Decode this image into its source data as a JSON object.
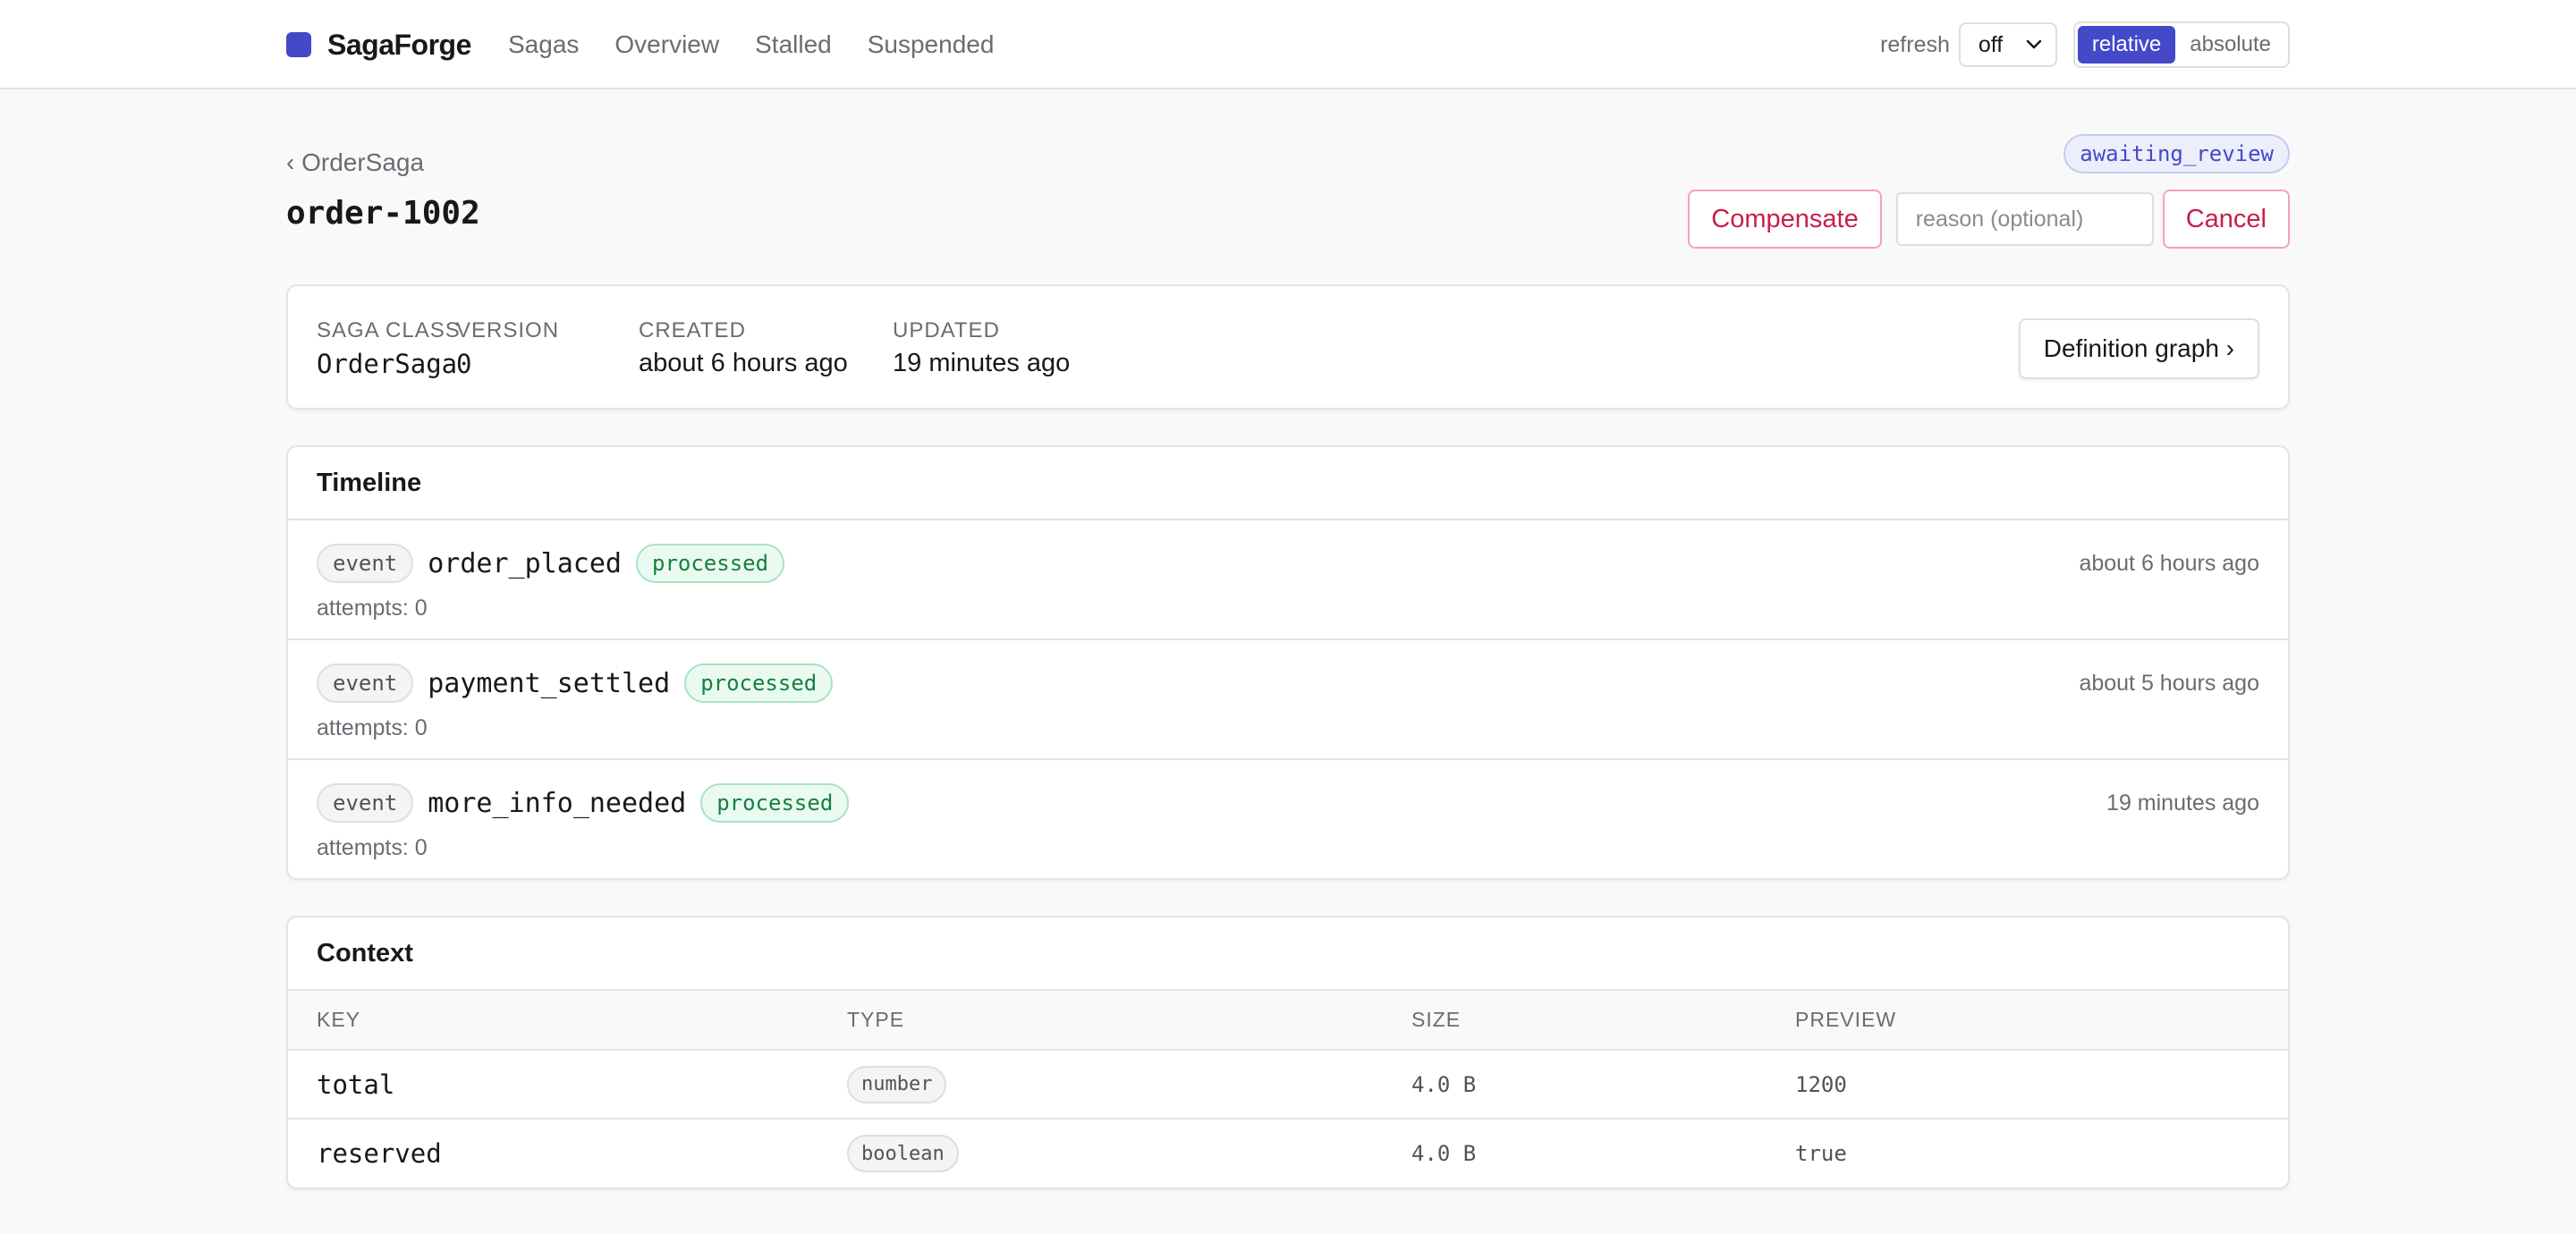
{
  "app": {
    "name": "SagaForge",
    "brand_color": "#4449c9"
  },
  "nav": {
    "items": [
      "Sagas",
      "Overview",
      "Stalled",
      "Suspended"
    ]
  },
  "toolbar": {
    "refresh_label": "refresh",
    "refresh_value": "off",
    "time_modes": [
      "relative",
      "absolute"
    ],
    "time_mode_selected": "relative"
  },
  "header": {
    "breadcrumb": "‹ OrderSaga",
    "title": "order-1002",
    "status": "awaiting_review",
    "compensate_label": "Compensate",
    "reason_placeholder": "reason (optional)",
    "cancel_label": "Cancel"
  },
  "summary": {
    "fields": [
      {
        "label": "SAGA CLASS",
        "value": "OrderSaga"
      },
      {
        "label": "VERSION",
        "value": "0"
      },
      {
        "label": "CREATED",
        "value": "about 6 hours ago"
      },
      {
        "label": "UPDATED",
        "value": "19 minutes ago"
      }
    ],
    "definition_button": "Definition graph ›"
  },
  "timeline": {
    "title": "Timeline",
    "entries": [
      {
        "kind": "event",
        "name": "order_placed",
        "status": "processed",
        "attempts": "attempts: 0",
        "time": "about 6 hours ago"
      },
      {
        "kind": "event",
        "name": "payment_settled",
        "status": "processed",
        "attempts": "attempts: 0",
        "time": "about 5 hours ago"
      },
      {
        "kind": "event",
        "name": "more_info_needed",
        "status": "processed",
        "attempts": "attempts: 0",
        "time": "19 minutes ago"
      }
    ]
  },
  "context": {
    "title": "Context",
    "columns": [
      "KEY",
      "TYPE",
      "SIZE",
      "PREVIEW"
    ],
    "rows": [
      {
        "key": "total",
        "type": "number",
        "size": "4.0 B",
        "preview": "1200"
      },
      {
        "key": "reserved",
        "type": "boolean",
        "size": "4.0 B",
        "preview": "true"
      }
    ]
  },
  "colors": {
    "status_processed": "#15803d",
    "danger": "#c81e4b",
    "status_awaiting": "#4449c9"
  }
}
